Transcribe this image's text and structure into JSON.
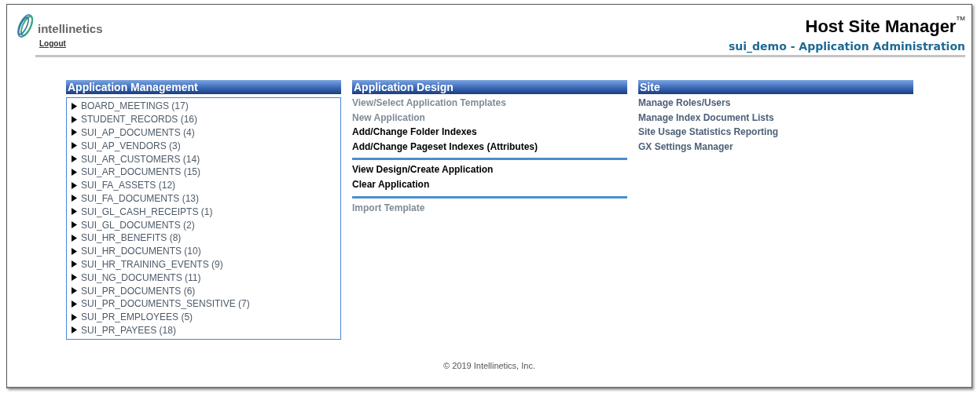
{
  "header": {
    "logo_text": "intellinetics",
    "logout": "Logout",
    "title": "Host Site Manager",
    "trademark": "TM",
    "subtitle": "sui_demo -  Application Administration"
  },
  "management": {
    "title": "Application Management",
    "items": [
      {
        "label": "BOARD_MEETINGS (17)",
        "expanded": false
      },
      {
        "label": "STUDENT_RECORDS (16)",
        "expanded": false
      },
      {
        "label": "SUI_AP_DOCUMENTS (4)",
        "expanded": false
      },
      {
        "label": "SUI_AP_VENDORS (3)",
        "expanded": false
      },
      {
        "label": "SUI_AR_CUSTOMERS (14)",
        "expanded": false
      },
      {
        "label": "SUI_AR_DOCUMENTS (15)",
        "expanded": false
      },
      {
        "label": "SUI_FA_ASSETS (12)",
        "expanded": false
      },
      {
        "label": "SUI_FA_DOCUMENTS (13)",
        "expanded": false
      },
      {
        "label": "SUI_GL_CASH_RECEIPTS (1)",
        "expanded": false
      },
      {
        "label": "SUI_GL_DOCUMENTS (2)",
        "expanded": false
      },
      {
        "label": "SUI_HR_BENEFITS (8)",
        "expanded": false
      },
      {
        "label": "SUI_HR_DOCUMENTS (10)",
        "expanded": false
      },
      {
        "label": "SUI_HR_TRAINING_EVENTS (9)",
        "expanded": false
      },
      {
        "label": "SUI_NG_DOCUMENTS (11)",
        "expanded": false
      },
      {
        "label": "SUI_PR_DOCUMENTS (6)",
        "expanded": false
      },
      {
        "label": "SUI_PR_DOCUMENTS_SENSITIVE (7)",
        "expanded": false
      },
      {
        "label": "SUI_PR_EMPLOYEES (5)",
        "expanded": false
      },
      {
        "label": "SUI_PR_PAYEES (18)",
        "expanded": false
      }
    ]
  },
  "design": {
    "title": "Application Design",
    "groups": [
      [
        {
          "label": "View/Select Application Templates",
          "disabled": true
        },
        {
          "label": "New Application",
          "disabled": true
        },
        {
          "label": "Add/Change Folder Indexes",
          "disabled": false
        },
        {
          "label": "Add/Change Pageset Indexes (Attributes)",
          "disabled": false
        }
      ],
      [
        {
          "label": "View Design/Create Application",
          "disabled": false
        },
        {
          "label": "Clear Application",
          "disabled": false
        }
      ],
      [
        {
          "label": "Import Template",
          "disabled": true
        }
      ]
    ]
  },
  "site": {
    "title": "Site",
    "links": [
      "Manage Roles/Users",
      "Manage Index Document Lists",
      "Site Usage Statistics Reporting",
      "GX Settings Manager"
    ]
  },
  "footer": "© 2019 Intellinetics, Inc."
}
